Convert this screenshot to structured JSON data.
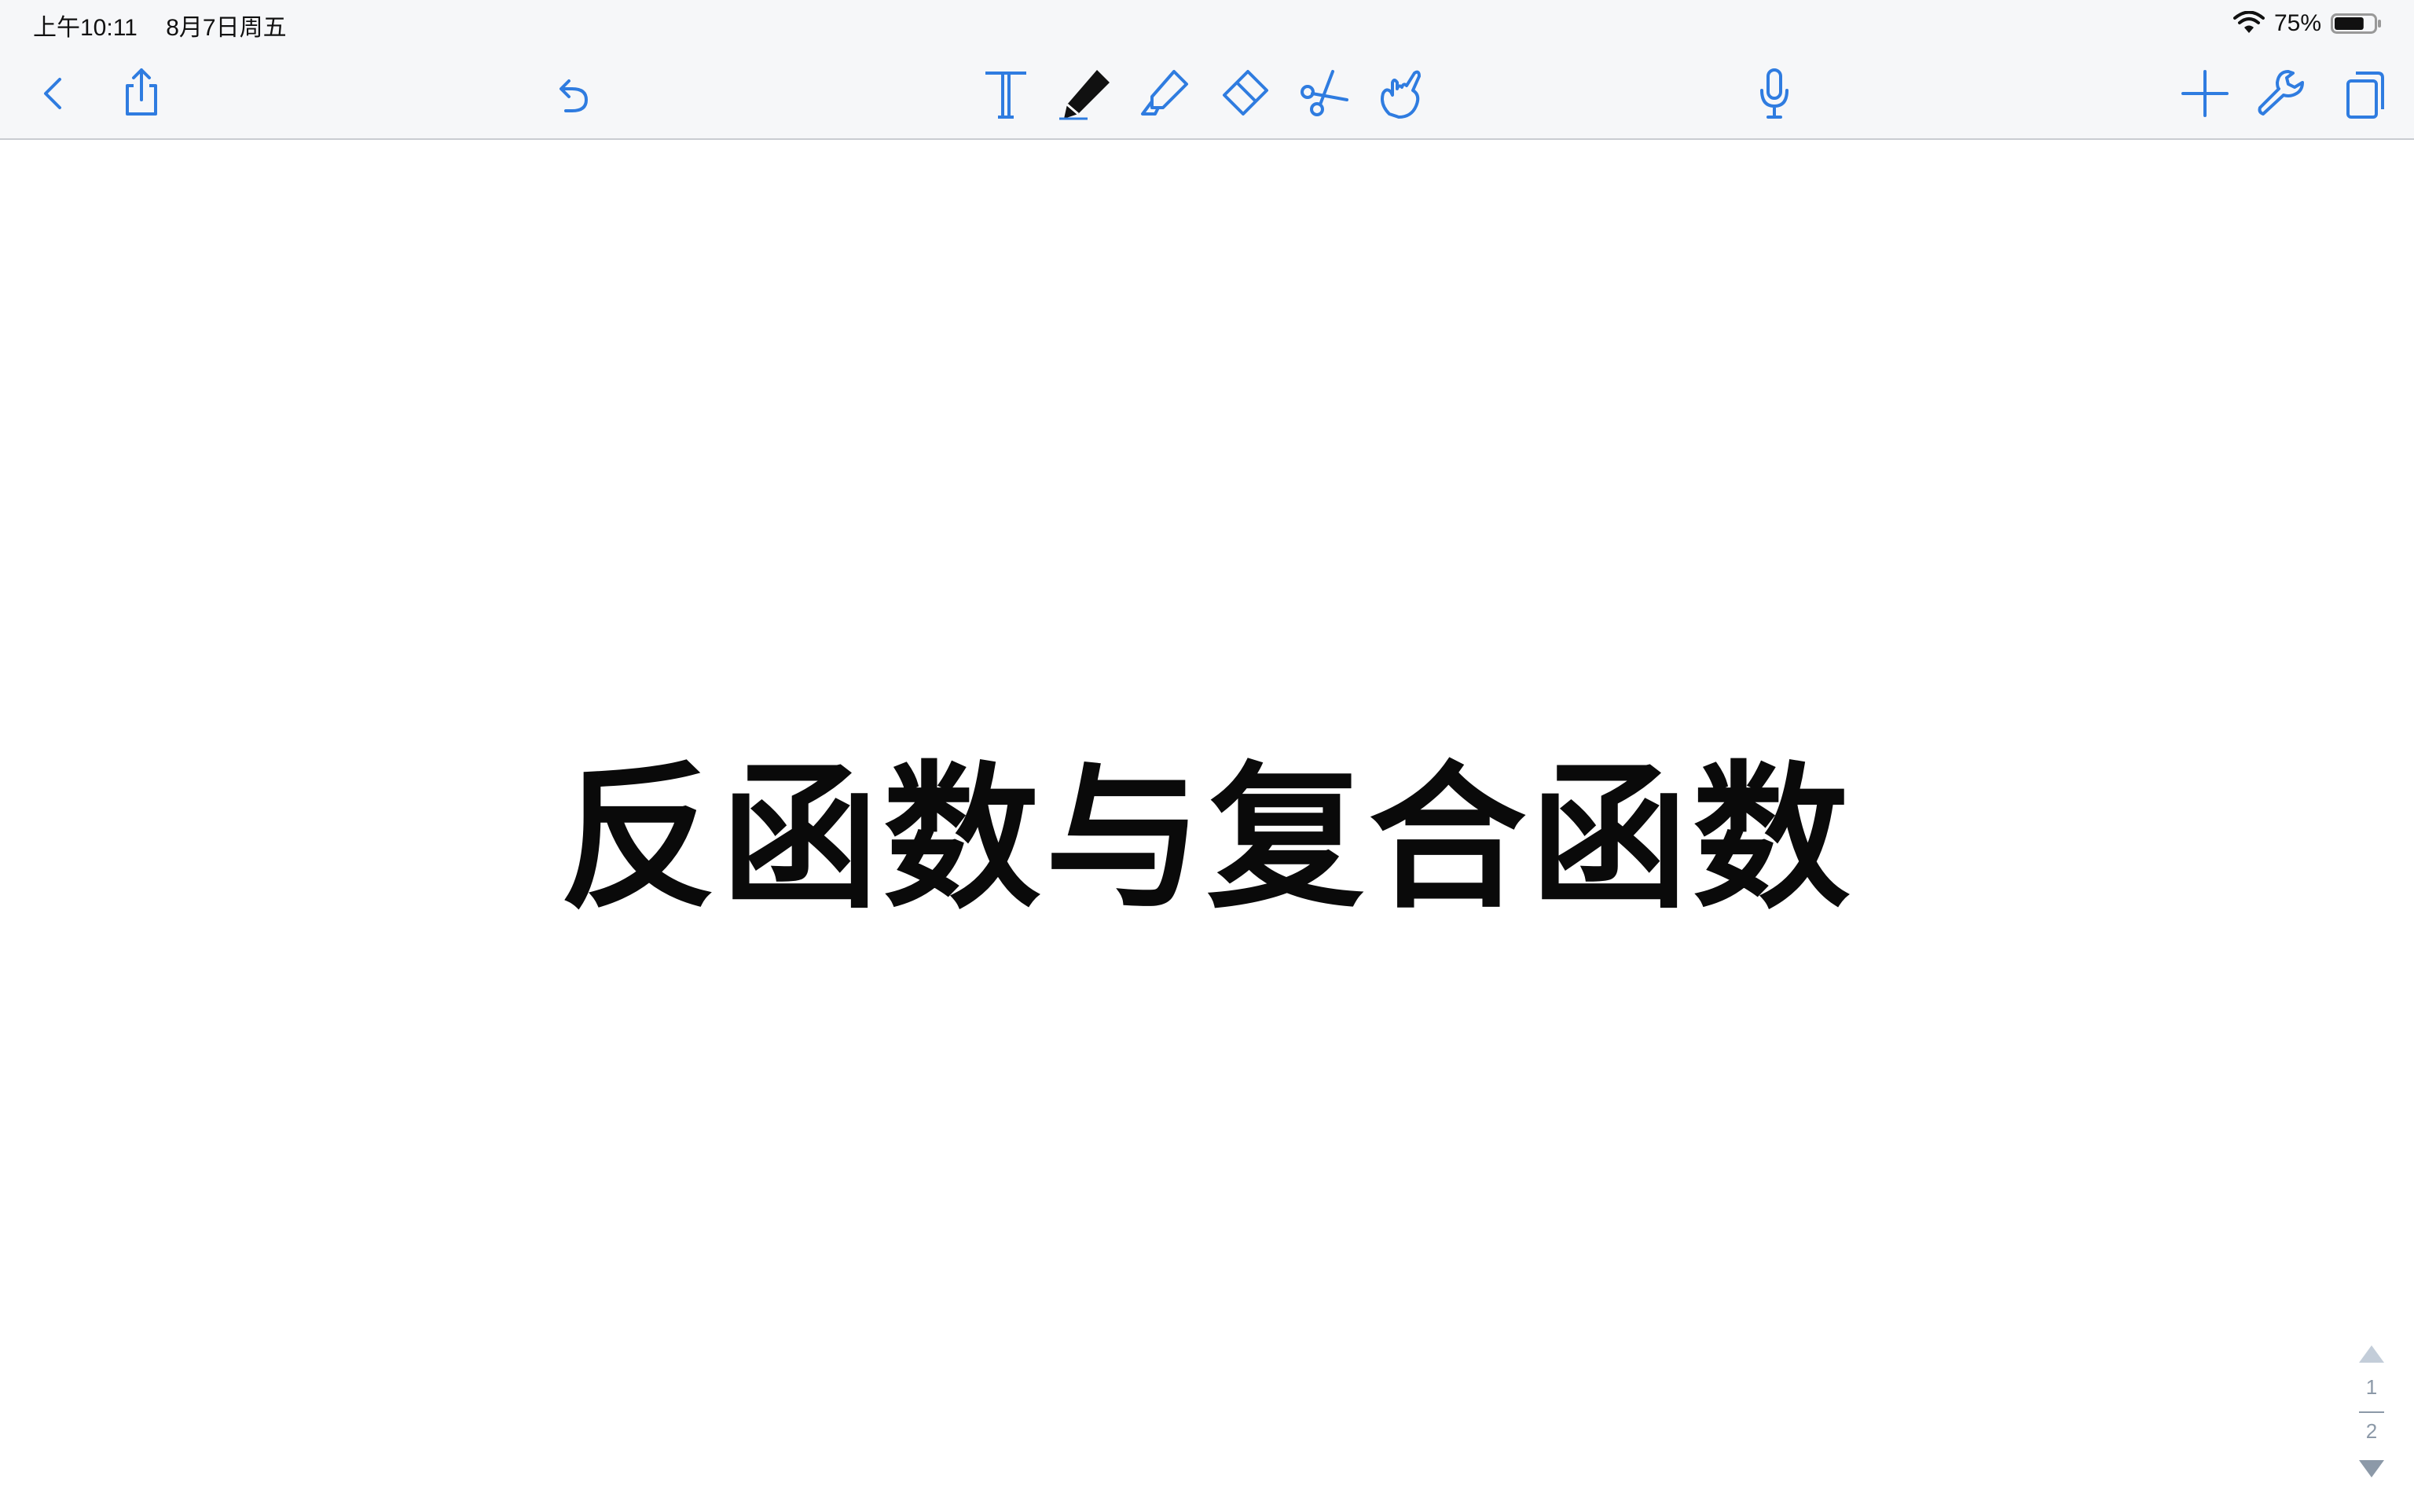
{
  "status_bar": {
    "time": "上午10:11",
    "date": "8月7日周五",
    "battery_percent": "75%",
    "battery_level": 0.75,
    "wifi_icon": "wifi-icon",
    "battery_icon": "battery-icon"
  },
  "toolbar": {
    "left": [
      "back-icon",
      "share-icon",
      "undo-icon"
    ],
    "tools": [
      "text-tool-icon",
      "pen-icon",
      "highlighter-icon",
      "eraser-icon",
      "scissors-icon",
      "hand-icon"
    ],
    "center_right": [
      "microphone-icon"
    ],
    "right": [
      "add-icon",
      "wrench-icon",
      "pages-icon"
    ],
    "active_tool": "pen-icon",
    "accent_color": "#2f7ce0"
  },
  "document": {
    "title": "反函数与复合函数"
  },
  "page_nav": {
    "current": "1",
    "total": "2"
  }
}
